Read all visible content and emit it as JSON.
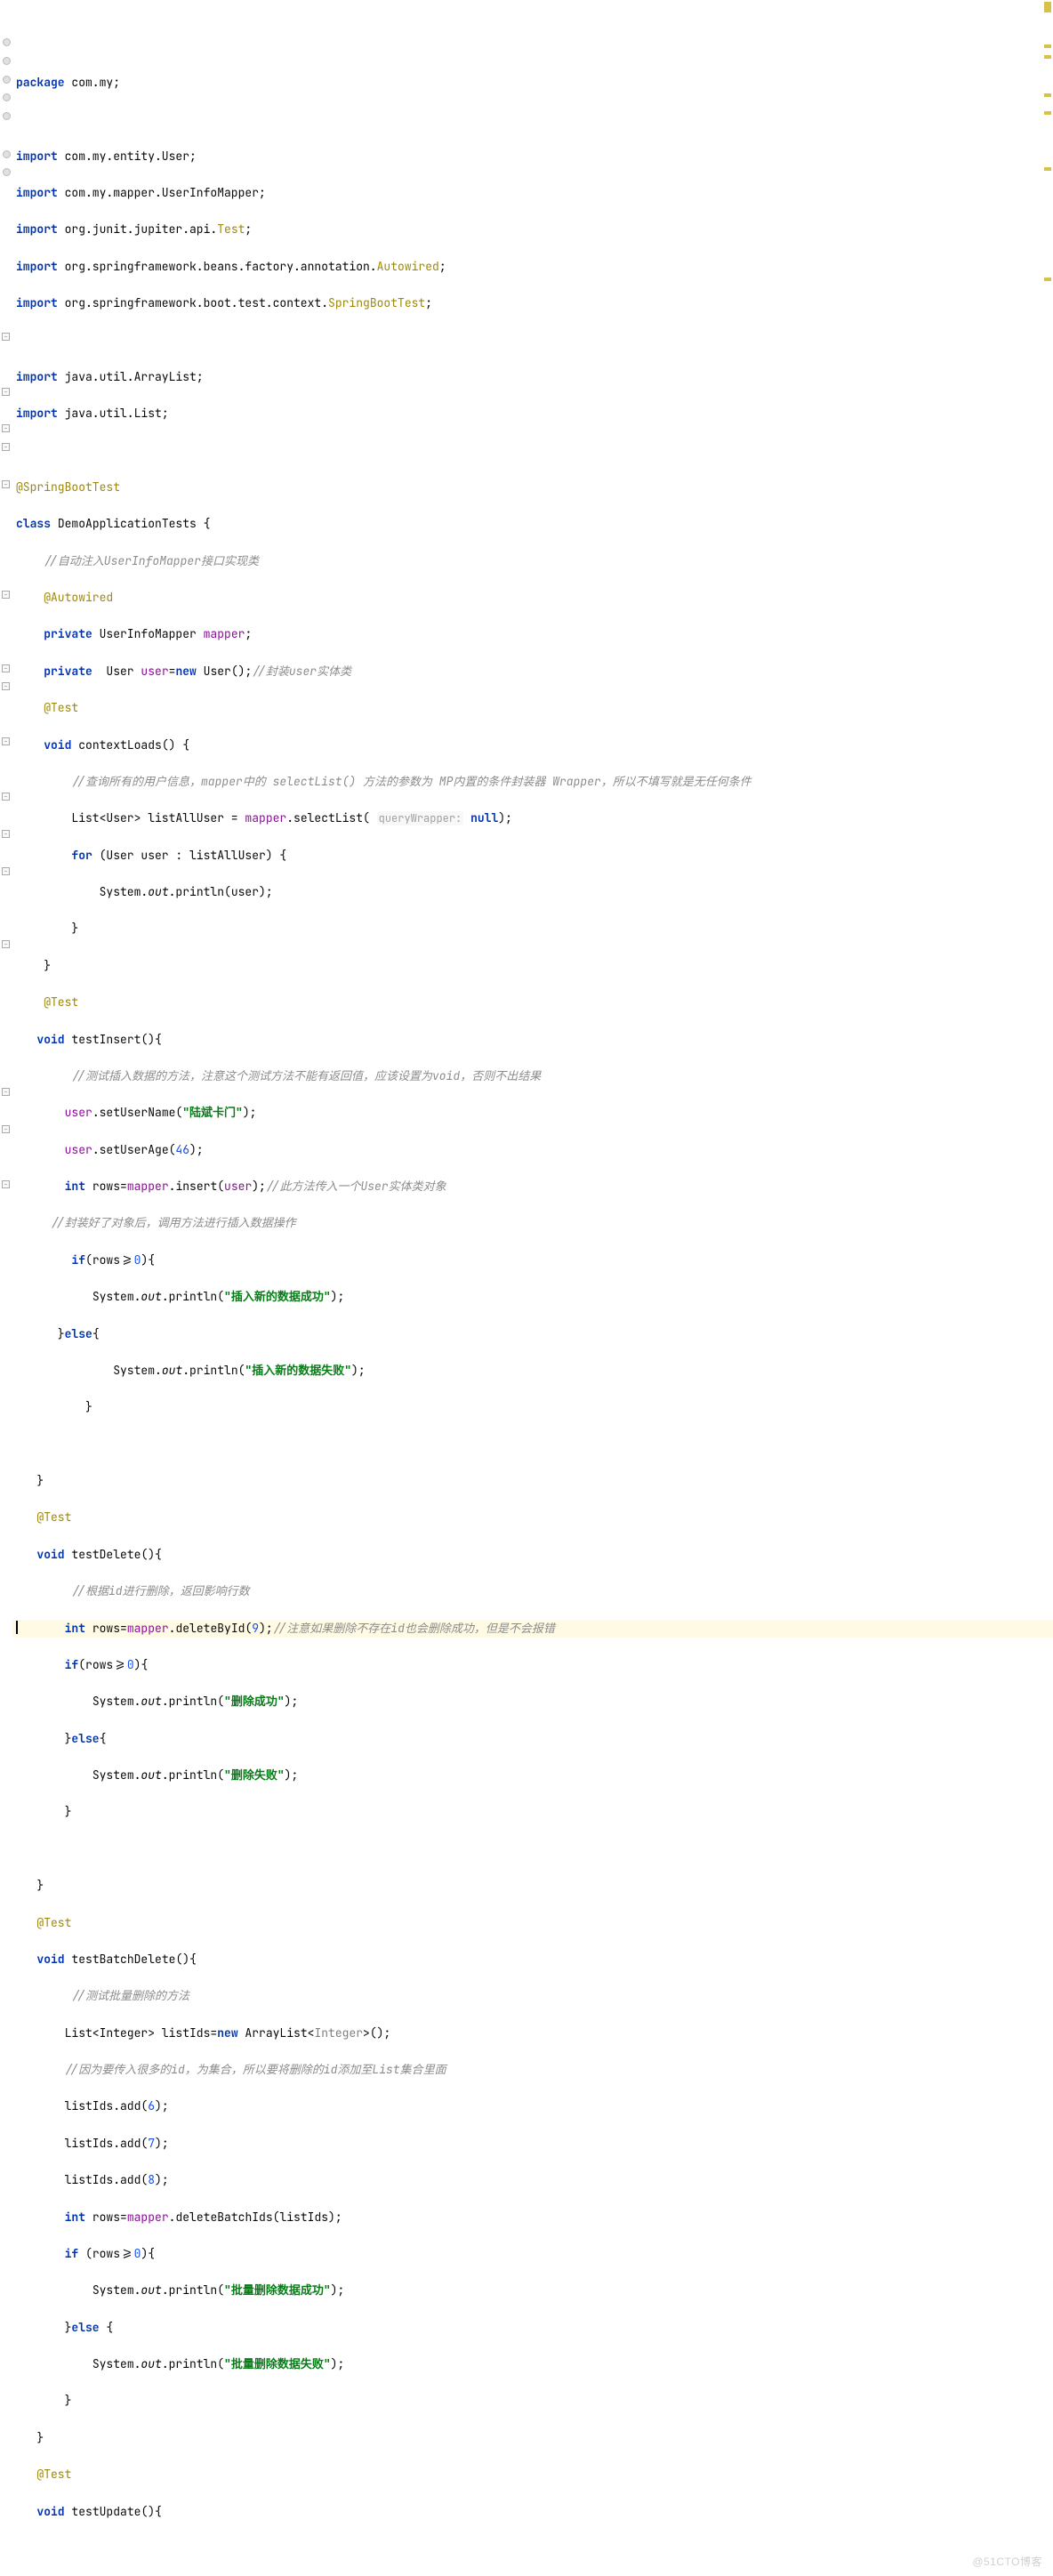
{
  "package_line": "package com.my;",
  "imports": [
    {
      "pre": "import ",
      "mid": "com.my.entity.User",
      "post": ";"
    },
    {
      "pre": "import ",
      "mid": "com.my.mapper.UserInfoMapper",
      "post": ";"
    },
    {
      "pre": "import ",
      "mid": "org.junit.jupiter.api.",
      "cls": "Test",
      "post": ";"
    },
    {
      "pre": "import ",
      "mid": "org.springframework.beans.factory.annotation.",
      "cls": "Autowired",
      "post": ";"
    },
    {
      "pre": "import ",
      "mid": "org.springframework.boot.test.context.",
      "cls": "SpringBootTest",
      "post": ";"
    },
    {
      "pre": "import ",
      "mid": "java.util.ArrayList",
      "post": ";"
    },
    {
      "pre": "import ",
      "mid": "java.util.List",
      "post": ";"
    }
  ],
  "class_ann": "@SpringBootTest",
  "class_decl": {
    "cl": "class ",
    "name": "DemoApplicationTests",
    "brace": " {"
  },
  "cmt_mapper": "//自动注入UserInfoMapper接口实现类",
  "autowired": "@Autowired",
  "mapper_decl": {
    "priv": "private ",
    "type": "UserInfoMapper ",
    "name": "mapper",
    "end": ";"
  },
  "user_decl": {
    "priv": "private  ",
    "type": "User ",
    "name": "user",
    "eq": "=",
    "nw": "new ",
    "ctor": "User()",
    "end": ";",
    "cmt": "//封装user实体类"
  },
  "test_ann": "@Test",
  "contextLoads": {
    "vd": "void ",
    "nm": "contextLoads",
    "par": "() {"
  },
  "cmt_select": "//查询所有的用户信息，mapper中的 selectList() 方法的参数为 MP内置的条件封装器 Wrapper，所以不填写就是无任何条件",
  "listAllUser": {
    "a": "List<User> listAllUser = ",
    "b": "mapper",
    "c": ".selectList(",
    "hint": "queryWrapper:",
    "d": " null",
    "e": ");"
  },
  "for_line": {
    "a": "for ",
    "b": "(User user : listAllUser) {"
  },
  "sout_user": {
    "a": "System.",
    "b": "out",
    "c": ".println(user);"
  },
  "testInsert": {
    "vd": "void ",
    "nm": "testInsert",
    "par": "(){"
  },
  "cmt_insert": "//测试插入数据的方法，注意这个测试方法不能有返回值，应该设置为void，否则不出结果",
  "setUserName": {
    "a": "user",
    "b": ".setUserName(",
    "s": "\"陆斌卡门\"",
    "c": ");"
  },
  "setUserAge": {
    "a": "user",
    "b": ".setUserAge(",
    "n": "46",
    "c": ");"
  },
  "rows_insert": {
    "a": "int ",
    "b": "rows=",
    "c": "mapper",
    "d": ".insert(",
    "e": "user",
    "f": ");",
    "cmt": "//此方法传入一个User实体类对象"
  },
  "cmt_wrap": "//封装好了对象后，调用方法进行插入数据操作",
  "if_rows": {
    "a": "if",
    "b": "(rows>=",
    "n": "0",
    "c": "){"
  },
  "sout_ins_ok": {
    "a": "System.",
    "b": "out",
    "c": ".println(",
    "s": "\"插入新的数据成功\"",
    "d": ");"
  },
  "else": "}else{",
  "sout_ins_fail": {
    "a": "System.",
    "b": "out",
    "c": ".println(",
    "s": "\"插入新的数据失败\"",
    "d": ");"
  },
  "testDelete": {
    "vd": "void ",
    "nm": "testDelete",
    "par": "(){"
  },
  "cmt_delete": "//根据id进行删除，返回影响行数",
  "rows_delete": {
    "a": "int ",
    "b": "rows=",
    "c": "mapper",
    "d": ".deleteById(",
    "n": "9",
    "e": ");",
    "cmt": "//注意如果删除不存在id也会删除成功，但是不会报错"
  },
  "if_rows2": {
    "a": "if",
    "b": "(rows>=",
    "n": "0",
    "c": "){"
  },
  "sout_del_ok": {
    "a": "System.",
    "b": "out",
    "c": ".println(",
    "s": "\"删除成功\"",
    "d": ");"
  },
  "sout_del_fail": {
    "a": "System.",
    "b": "out",
    "c": ".println(",
    "s": "\"删除失败\"",
    "d": ");"
  },
  "testBatchDelete": {
    "vd": "void ",
    "nm": "testBatchDelete",
    "par": "(){"
  },
  "cmt_batch": "//测试批量删除的方法",
  "listIds_decl": {
    "a": "List<Integer> listIds=",
    "b": "new ",
    "c": "ArrayList<",
    "d": "Integer",
    "e": ">();"
  },
  "cmt_addids": "//因为要传入很多的id，为集合，所以要将删除的id添加至List集合里面",
  "add6": {
    "a": "listIds.add(",
    "n": "6",
    "b": ");"
  },
  "add7": {
    "a": "listIds.add(",
    "n": "7",
    "b": ");"
  },
  "add8": {
    "a": "listIds.add(",
    "n": "8",
    "b": ");"
  },
  "rows_batch": {
    "a": "int ",
    "b": "rows=",
    "c": "mapper",
    "d": ".deleteBatchIds(listIds);"
  },
  "if_rows3": {
    "a": "if ",
    "b": "(rows>=",
    "n": "0",
    "c": "){"
  },
  "sout_batch_ok": {
    "a": "System.",
    "b": "out",
    "c": ".println(",
    "s": "\"批量删除数据成功\"",
    "d": ");"
  },
  "else2": "}else {",
  "sout_batch_fail": {
    "a": "System.",
    "b": "out",
    "c": ".println(",
    "s": "\"批量删除数据失败\"",
    "d": ");"
  },
  "testUpdate": {
    "vd": "void ",
    "nm": "testUpdate",
    "par": "(){"
  },
  "close": "}",
  "watermark": "@51CTO博客"
}
